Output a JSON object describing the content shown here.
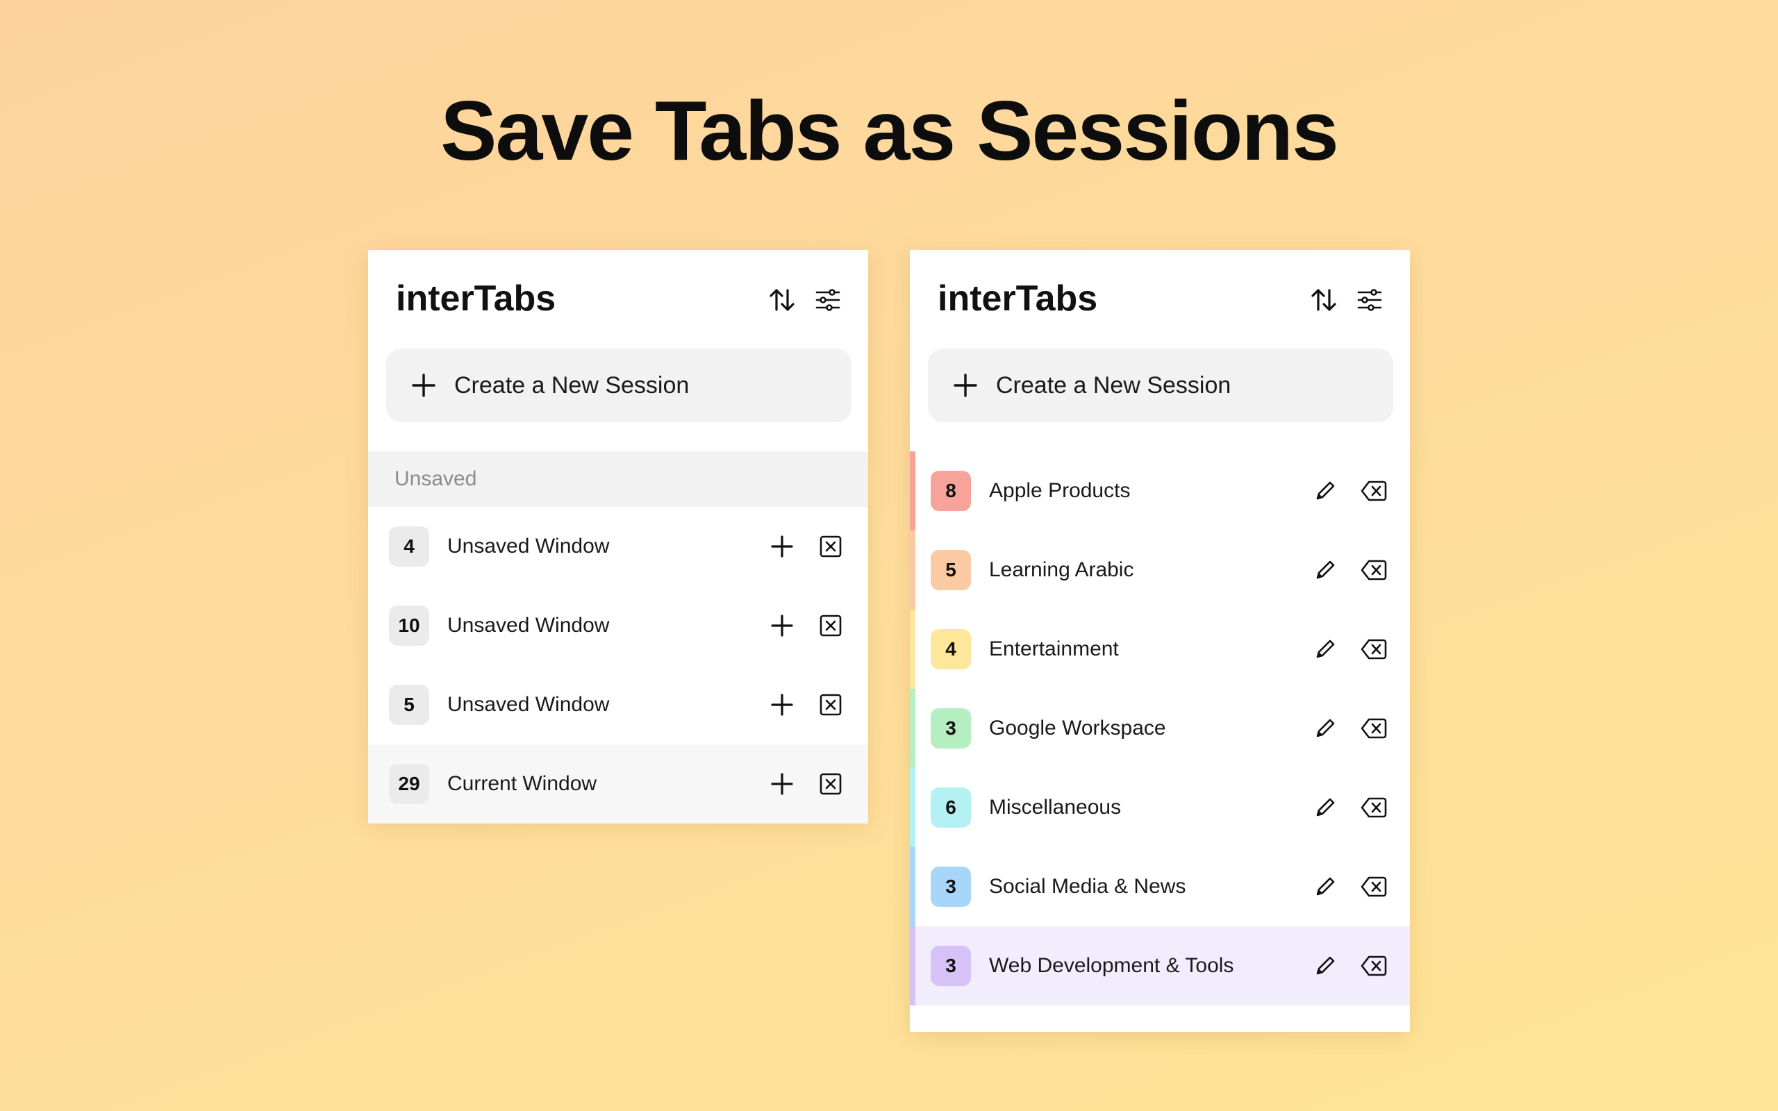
{
  "headline": "Save Tabs as Sessions",
  "left_panel": {
    "app_title": "interTabs",
    "header_icons": [
      "sort-arrows-icon",
      "sliders-icon"
    ],
    "create_button_label": "Create a New Session",
    "section_label": "Unsaved",
    "windows": [
      {
        "count": "4",
        "label": "Unsaved Window"
      },
      {
        "count": "10",
        "label": "Unsaved Window"
      },
      {
        "count": "5",
        "label": "Unsaved Window"
      },
      {
        "count": "29",
        "label": "Current Window"
      }
    ]
  },
  "right_panel": {
    "app_title": "interTabs",
    "header_icons": [
      "sort-arrows-icon",
      "sliders-icon"
    ],
    "create_button_label": "Create a New Session",
    "sessions": [
      {
        "count": "8",
        "label": "Apple Products",
        "color": "#f7a39a"
      },
      {
        "count": "5",
        "label": "Learning Arabic",
        "color": "#fbc9a2"
      },
      {
        "count": "4",
        "label": "Entertainment",
        "color": "#fde79a"
      },
      {
        "count": "3",
        "label": "Google Workspace",
        "color": "#b5eec0"
      },
      {
        "count": "6",
        "label": "Miscellaneous",
        "color": "#b4f1f2"
      },
      {
        "count": "3",
        "label": "Social Media & News",
        "color": "#a8d6f8"
      },
      {
        "count": "3",
        "label": "Web Development & Tools",
        "color": "#d7c2f7",
        "highlight": "#f1edfd"
      }
    ]
  },
  "colors": {
    "background_top": "#fdd29d",
    "background_bottom": "#fee595",
    "button_bg": "#f2f2f2"
  }
}
